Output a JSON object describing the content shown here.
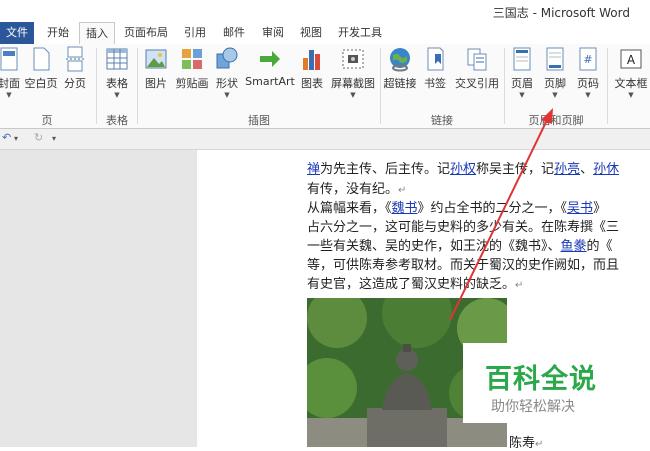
{
  "window": {
    "title": "三国志 - Microsoft Word"
  },
  "tabs": [
    "文件",
    "开始",
    "插入",
    "页面布局",
    "引用",
    "邮件",
    "审阅",
    "视图",
    "开发工具"
  ],
  "ribbon": {
    "page_group": {
      "label": "页",
      "buttons": [
        "封面",
        "空白页",
        "分页"
      ]
    },
    "table_group": {
      "label": "表格",
      "buttons": [
        "表格"
      ]
    },
    "illustrations_group": {
      "label": "插图",
      "buttons": [
        "图片",
        "剪贴画",
        "形状",
        "SmartArt",
        "图表",
        "屏幕截图"
      ]
    },
    "links_group": {
      "label": "链接",
      "buttons": [
        "超链接",
        "书签",
        "交叉引用"
      ]
    },
    "header_footer_group": {
      "label": "页眉和页脚",
      "buttons": [
        "页眉",
        "页脚",
        "页码"
      ]
    },
    "text_group": {
      "buttons": [
        "文本框"
      ]
    }
  },
  "document": {
    "line1": {
      "a": "禅",
      "b": "为先主传、后主传。记",
      "c": "孙权",
      "d": "称吴主传，记",
      "e": "孙亮",
      "f": "、",
      "g": "孙休"
    },
    "line2": "有传，没有纪。",
    "line3": {
      "a": "从篇幅来看，《",
      "b": "魏书",
      "c": "》约占全书的二分之一，《",
      "d": "吴书",
      "e": "》"
    },
    "line4": "占六分之一，这可能与史料的多少有关。在陈寿撰《三",
    "line5": {
      "a": "一些有关魏、吴的史作，如王沈的《魏书》、",
      "b": "鱼豢",
      "c": "的《"
    },
    "line6": "等，可供陈寿参考取材。而关于蜀汉的史作阙如，而且",
    "line7": "有史官，这造成了蜀汉史料的缺乏。",
    "caption": "陈寿"
  },
  "watermark": {
    "main": "百科全说",
    "sub": "助你轻松解决"
  }
}
